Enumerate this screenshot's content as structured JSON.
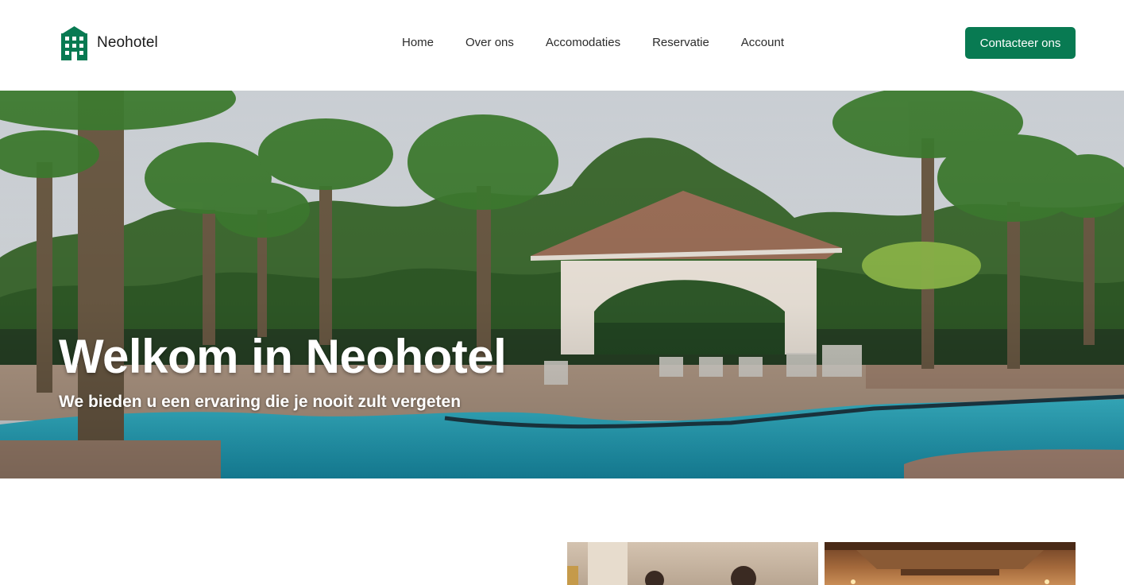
{
  "brand": {
    "name": "Neohotel",
    "icon": "hotel-building-icon",
    "color": "#087a52"
  },
  "nav": {
    "items": [
      {
        "label": "Home"
      },
      {
        "label": "Over ons"
      },
      {
        "label": "Accomodaties"
      },
      {
        "label": "Reservatie"
      },
      {
        "label": "Account"
      }
    ]
  },
  "cta": {
    "label": "Contacteer ons",
    "color": "#087a52"
  },
  "hero": {
    "title": "Welkom in Neohotel",
    "subtitle": "We bieden u een ervaring die je nooit zult vergeten",
    "image": "resort-pool-with-palm-trees-and-gazebo"
  },
  "gallery": {
    "images": [
      "hotel-reception-staff-photo",
      "hotel-lobby-ceiling-photo"
    ]
  }
}
